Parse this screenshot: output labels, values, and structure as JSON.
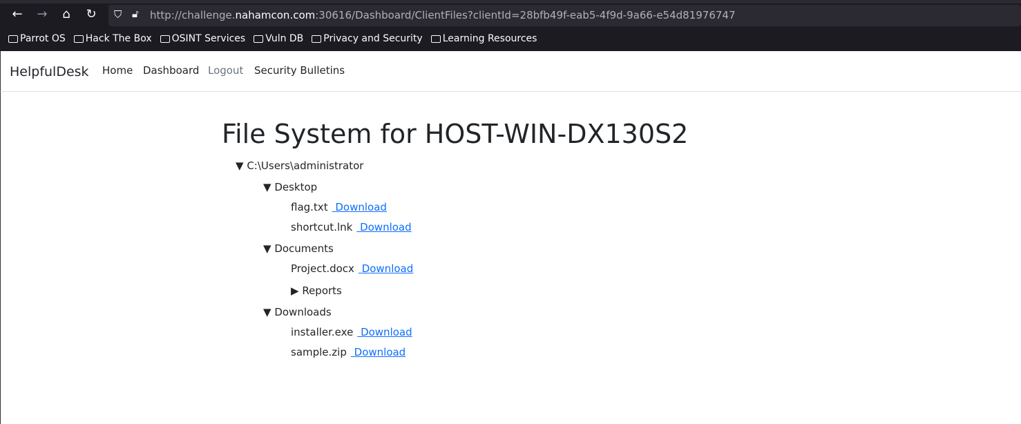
{
  "browser": {
    "url_prefix": "http://challenge.",
    "url_domain": "nahamcon.com",
    "url_suffix": ":30616/Dashboard/ClientFiles?clientId=28bfb49f-eab5-4f9d-9a66-e54d81976747",
    "bookmarks": [
      "Parrot OS",
      "Hack The Box",
      "OSINT Services",
      "Vuln DB",
      "Privacy and Security",
      "Learning Resources"
    ]
  },
  "navbar": {
    "brand": "HelpfulDesk",
    "links": [
      "Home",
      "Dashboard",
      "Logout",
      "Security Bulletins"
    ]
  },
  "page": {
    "title": "File System for HOST-WIN-DX130S2",
    "download_label": " Download",
    "tree": {
      "root": "C:\\Users\\administrator",
      "desktop": "Desktop",
      "desktop_files": [
        "flag.txt",
        "shortcut.lnk"
      ],
      "documents": "Documents",
      "documents_files": [
        "Project.docx"
      ],
      "reports": "Reports",
      "downloads": "Downloads",
      "downloads_files": [
        "installer.exe",
        "sample.zip"
      ]
    },
    "expanded_marker": "▼",
    "collapsed_marker": "▶"
  }
}
